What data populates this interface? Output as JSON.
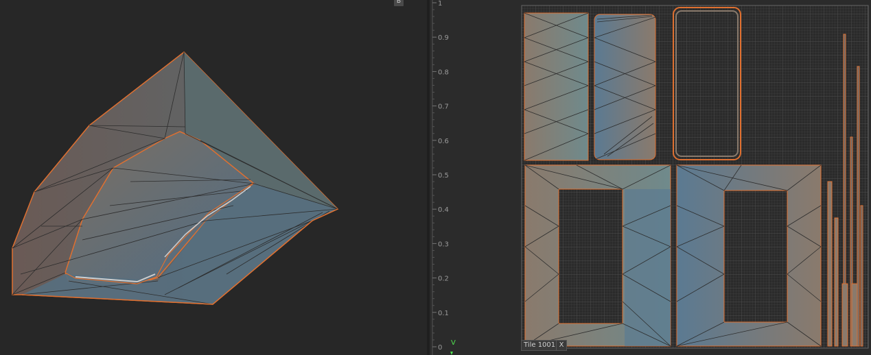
{
  "viewport": {
    "badge": "B"
  },
  "uv_editor": {
    "ruler_labels": [
      "1",
      "0.9",
      "0.8",
      "0.7",
      "0.6",
      "0.5",
      "0.4",
      "0.3",
      "0.2",
      "0.1",
      "0"
    ],
    "axis_label": "V",
    "tile_label": "Tile 1001",
    "close_label": "X"
  },
  "colors": {
    "edge_highlight": "#e07030",
    "face_warm": "#8a7a6c",
    "face_cool": "#5b7a92",
    "background": "#272727"
  }
}
